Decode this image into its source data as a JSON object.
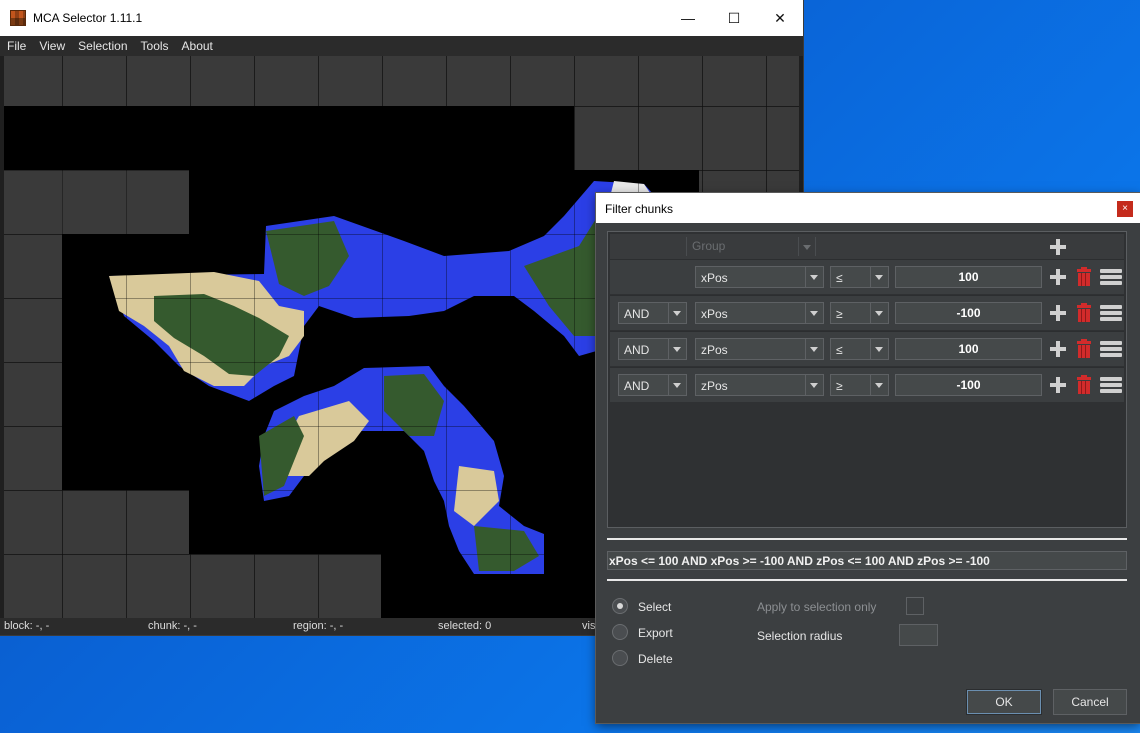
{
  "main_window": {
    "title": "MCA Selector 1.11.1",
    "controls": {
      "minimize": "—",
      "maximize": "☐",
      "close": "✕"
    },
    "menu": [
      "File",
      "View",
      "Selection",
      "Tools",
      "About"
    ],
    "status": {
      "block": "block: -, -",
      "chunk": "chunk: -, -",
      "region": "region: -, -",
      "selected": "selected: 0",
      "visible": "vis"
    },
    "colors": {
      "water": "#2b3fe6",
      "land": "#355a2e",
      "sand": "#d9c99a",
      "void": "#000000",
      "tile": "#3a3a3a"
    }
  },
  "dialog": {
    "title": "Filter chunks",
    "close": "×",
    "header": {
      "group_label": "Group"
    },
    "filters": [
      {
        "operator": "",
        "field": "xPos",
        "comparator": "≤",
        "value": "100"
      },
      {
        "operator": "AND",
        "field": "xPos",
        "comparator": "≥",
        "value": "-100"
      },
      {
        "operator": "AND",
        "field": "zPos",
        "comparator": "≤",
        "value": "100"
      },
      {
        "operator": "AND",
        "field": "zPos",
        "comparator": "≥",
        "value": "-100"
      }
    ],
    "expression": "xPos <= 100 AND xPos >= -100 AND zPos <= 100 AND zPos >= -100",
    "actions": {
      "select": "Select",
      "export": "Export",
      "delete": "Delete",
      "selected": "select"
    },
    "options": {
      "apply_to_selection": "Apply to selection only",
      "selection_radius": "Selection radius"
    },
    "buttons": {
      "ok": "OK",
      "cancel": "Cancel"
    }
  }
}
